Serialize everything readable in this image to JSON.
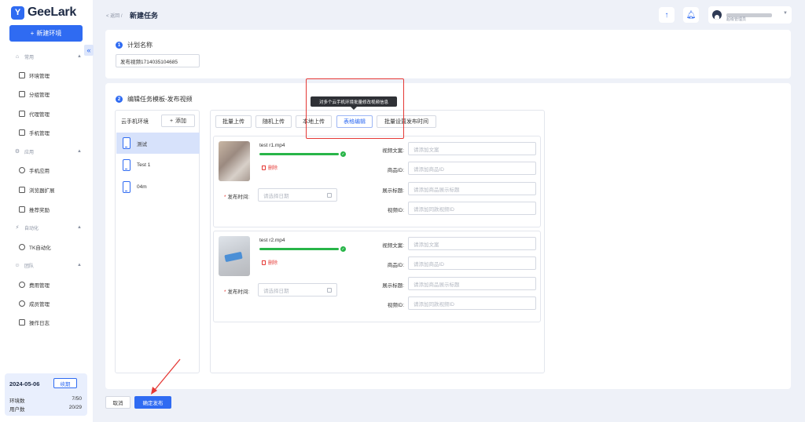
{
  "app": {
    "logo_glyph": "Y",
    "logo_text": "GeeLark",
    "new_env_label": "新建环境",
    "collapse_glyph": "«"
  },
  "sidebar": {
    "groups": [
      {
        "label": "常用",
        "icon": "home-icon"
      },
      {
        "label": "应用",
        "icon": "apps-icon"
      },
      {
        "label": "自动化",
        "icon": "automation-icon"
      },
      {
        "label": "团队",
        "icon": "team-icon"
      }
    ],
    "items": [
      {
        "label": "环境管理"
      },
      {
        "label": "分组管理"
      },
      {
        "label": "代理管理"
      },
      {
        "label": "手机管理"
      },
      {
        "label": "手机应用"
      },
      {
        "label": "浏览器扩展"
      },
      {
        "label": "推荐奖励"
      },
      {
        "label": "TK自动化"
      },
      {
        "label": "费用管理"
      },
      {
        "label": "成员管理"
      },
      {
        "label": "操作日志"
      }
    ],
    "footer": {
      "date": "2024-05-06",
      "renew_label": "续期",
      "env_count_label": "环境数",
      "env_count_value": "7/50",
      "user_count_label": "用户数",
      "user_count_value": "20/29"
    }
  },
  "header": {
    "back_label": "< 返回 /",
    "title": "新建任务",
    "user_role": "超级管理员"
  },
  "step1": {
    "number": "1",
    "title": "计划名称",
    "plan_name_value": "发布视频1714035104685"
  },
  "step2": {
    "number": "2",
    "title": "编辑任务模板-发布视频",
    "phone_list_title": "云手机环境",
    "add_label": "添加",
    "phones": [
      {
        "name": "测试"
      },
      {
        "name": "Test 1"
      },
      {
        "name": "04m"
      }
    ],
    "toolbar": {
      "batch_upload": "批量上传",
      "random_upload": "随机上传",
      "local_upload": "本地上传",
      "table_edit": "表格编辑",
      "batch_set_time": "批量设置发布时间"
    },
    "tooltip": "对多个云手机环境批量修改视频信息",
    "videos": [
      {
        "file_name": "test r1.mp4",
        "progress": 1.0
      },
      {
        "file_name": "test r2.mp4",
        "progress": 1.0
      }
    ],
    "delete_label": "删除",
    "publish_time_label": "发布时间:",
    "date_placeholder": "请选择日期",
    "fields": [
      {
        "label": "视频文案:",
        "placeholder": "请添加文案"
      },
      {
        "label": "商品ID:",
        "placeholder": "请添加商品ID"
      },
      {
        "label": "展示标题:",
        "placeholder": "请添加商品展示标题"
      },
      {
        "label": "视频ID:",
        "placeholder": "请添加同款视频ID"
      }
    ]
  },
  "footer_actions": {
    "cancel_label": "取消",
    "confirm_label": "确定发布"
  },
  "colors": {
    "primary": "#2f6bf2",
    "success": "#28b548",
    "danger": "#e53935",
    "highlight_box": "#e53935"
  }
}
